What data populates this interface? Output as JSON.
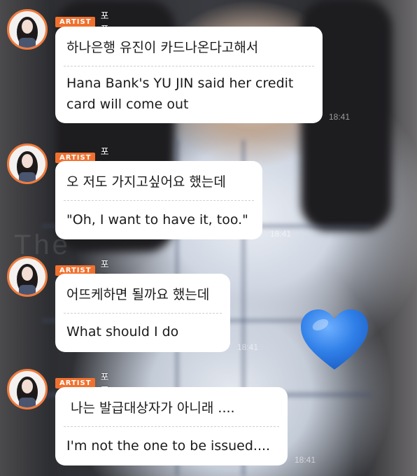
{
  "background": {
    "watermark": "The",
    "emoji": "blue-heart"
  },
  "colors": {
    "badge": "#f0712f",
    "avatar_ring": "#f07b3d",
    "bubble": "#ffffff"
  },
  "messages": [
    {
      "badge": "ARTIST",
      "nickname": "포포",
      "korean": "하나은행 유진이 카드나온다고해서",
      "english_lines": [
        "Hana Bank's YU JIN said her credit",
        "card will come out"
      ],
      "time": "18:41"
    },
    {
      "badge": "ARTIST",
      "nickname": "포포",
      "korean": "오 저도 가지고싶어요 했는데",
      "english_lines": [
        "\"Oh, I want to have it, too.\""
      ],
      "time": "18:41"
    },
    {
      "badge": "ARTIST",
      "nickname": "포포",
      "korean": "어뜨케하면 될까요 했는데",
      "english_lines": [
        "What should I do"
      ],
      "time": "18:41"
    },
    {
      "badge": "ARTIST",
      "nickname": "포포",
      "korean": "나는 발급대상자가 아니래 ....",
      "english_lines": [
        "I'm not the one to be issued...."
      ],
      "time": "18:41"
    }
  ]
}
